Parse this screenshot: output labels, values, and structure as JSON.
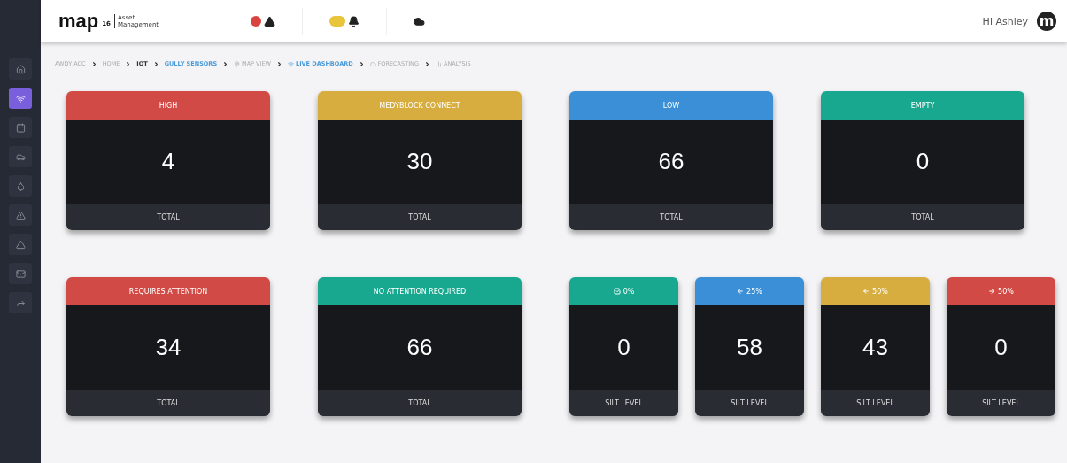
{
  "sidebar": {
    "items": [
      {
        "kind": "home",
        "selected": false
      },
      {
        "kind": "signal",
        "selected": true
      },
      {
        "kind": "calendar",
        "selected": false
      },
      {
        "kind": "car",
        "selected": false
      },
      {
        "kind": "drop",
        "selected": false
      },
      {
        "kind": "warning",
        "selected": false
      },
      {
        "kind": "triangle",
        "selected": false
      },
      {
        "kind": "mail",
        "selected": false
      },
      {
        "kind": "forward",
        "selected": false
      }
    ]
  },
  "header": {
    "logo": "map",
    "logo_mark": "16",
    "logo_sub": "Asset Management",
    "alerts": [
      {
        "kind": "warning",
        "color": "#d9443f"
      },
      {
        "kind": "bell",
        "color": "#e8c53a"
      },
      {
        "kind": "cloud"
      }
    ],
    "greeting": "Hi Ashley",
    "avatar": "m"
  },
  "breadcrumb": [
    {
      "label": "AWDY ACC",
      "kind": "plain"
    },
    {
      "label": "HOME",
      "kind": "plain"
    },
    {
      "label": "IOT",
      "kind": "bold"
    },
    {
      "label": "GULLY SENSORS",
      "kind": "link"
    },
    {
      "label": "MAP VIEW",
      "kind": "pin"
    },
    {
      "label": "LIVE DASHBOARD",
      "kind": "live"
    },
    {
      "label": "FORECASTING",
      "kind": "cloud"
    },
    {
      "label": "ANALYSIS",
      "kind": "chart"
    }
  ],
  "cards": [
    [
      {
        "title": "HIGH",
        "color": "#d24a45",
        "value": "4",
        "footer": "TOTAL",
        "kind": "wide"
      },
      {
        "title": "MEDYBLOCK CONNECT",
        "color": "#d6ad3e",
        "value": "30",
        "footer": "TOTAL",
        "kind": "wide"
      },
      {
        "title": "LOW",
        "color": "#3a8fd6",
        "value": "66",
        "footer": "TOTAL",
        "kind": "wide"
      },
      {
        "title": "EMPTY",
        "color": "#18a88f",
        "value": "0",
        "footer": "TOTAL",
        "kind": "wide"
      }
    ],
    [
      {
        "title": "REQUIRES ATTENTION",
        "color": "#d24a45",
        "value": "34",
        "footer": "TOTAL",
        "kind": "wide"
      },
      {
        "title": "NO ATTENTION REQUIRED",
        "color": "#18a88f",
        "value": "66",
        "footer": "TOTAL",
        "kind": "wide"
      },
      {
        "title": "0%",
        "kind": "check",
        "color": "#18a88f",
        "value": "0",
        "footer": "SILT LEVEL"
      },
      {
        "title": "25%",
        "kind": "left",
        "color": "#3a8fd6",
        "value": "58",
        "footer": "SILT LEVEL"
      },
      {
        "title": "50%",
        "kind": "left",
        "color": "#d6ad3e",
        "value": "43",
        "footer": "SILT LEVEL"
      },
      {
        "title": "50%",
        "kind": "right",
        "color": "#d24a45",
        "value": "0",
        "footer": "SILT LEVEL"
      }
    ]
  ]
}
